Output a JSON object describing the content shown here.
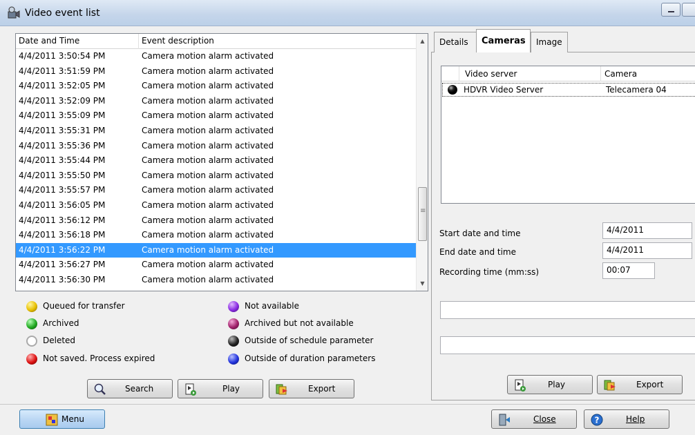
{
  "window": {
    "title": "Video event list"
  },
  "event_list": {
    "columns": [
      "Date and Time",
      "Event description"
    ],
    "rows": [
      {
        "datetime": "4/4/2011 3:50:54 PM",
        "description": "Camera motion alarm activated"
      },
      {
        "datetime": "4/4/2011 3:51:59 PM",
        "description": "Camera motion alarm activated"
      },
      {
        "datetime": "4/4/2011 3:52:05 PM",
        "description": "Camera motion alarm activated"
      },
      {
        "datetime": "4/4/2011 3:52:09 PM",
        "description": "Camera motion alarm activated"
      },
      {
        "datetime": "4/4/2011 3:55:09 PM",
        "description": "Camera motion alarm activated"
      },
      {
        "datetime": "4/4/2011 3:55:31 PM",
        "description": "Camera motion alarm activated"
      },
      {
        "datetime": "4/4/2011 3:55:36 PM",
        "description": "Camera motion alarm activated"
      },
      {
        "datetime": "4/4/2011 3:55:44 PM",
        "description": "Camera motion alarm activated"
      },
      {
        "datetime": "4/4/2011 3:55:50 PM",
        "description": "Camera motion alarm activated"
      },
      {
        "datetime": "4/4/2011 3:55:57 PM",
        "description": "Camera motion alarm activated"
      },
      {
        "datetime": "4/4/2011 3:56:05 PM",
        "description": "Camera motion alarm activated"
      },
      {
        "datetime": "4/4/2011 3:56:12 PM",
        "description": "Camera motion alarm activated"
      },
      {
        "datetime": "4/4/2011 3:56:18 PM",
        "description": "Camera motion alarm activated"
      },
      {
        "datetime": "4/4/2011 3:56:22 PM",
        "description": "Camera motion alarm activated"
      },
      {
        "datetime": "4/4/2011 3:56:27 PM",
        "description": "Camera motion alarm activated"
      },
      {
        "datetime": "4/4/2011 3:56:30 PM",
        "description": "Camera motion alarm activated"
      }
    ],
    "selected_index": 13
  },
  "legend": [
    {
      "label": "Queued for transfer",
      "color": "#e8c000"
    },
    {
      "label": "Not available",
      "color": "#8a2be2"
    },
    {
      "label": "Archived",
      "color": "#22aa22"
    },
    {
      "label": "Archived but not available",
      "color": "#a0206a"
    },
    {
      "label": "Deleted",
      "color": "#ffffff"
    },
    {
      "label": "Outside of schedule parameter",
      "color": "#222222"
    },
    {
      "label": "Not saved. Process expired",
      "color": "#dd1111"
    },
    {
      "label": "Outside of duration parameters",
      "color": "#2233dd"
    }
  ],
  "left_buttons": {
    "search": "Search",
    "play": "Play",
    "export": "Export"
  },
  "tabs": [
    "Details",
    "Cameras",
    "Image"
  ],
  "active_tab": "Cameras",
  "cameras_table": {
    "columns": [
      "Video server",
      "Camera"
    ],
    "rows": [
      {
        "server": "HDVR Video Server",
        "camera": "Telecamera 04"
      }
    ]
  },
  "form": {
    "start_label": "Start date and time",
    "start_value": "4/4/2011",
    "end_label": "End date and time",
    "end_value": "4/4/2011",
    "recording_label": "Recording time (mm:ss)",
    "recording_value": "00:07"
  },
  "right_buttons": {
    "play": "Play",
    "export": "Export"
  },
  "bottom": {
    "menu": "Menu",
    "close": "Close",
    "help": "Help"
  },
  "colors": {
    "selection": "#3399ff",
    "menu_button": "#bcd8f4"
  }
}
